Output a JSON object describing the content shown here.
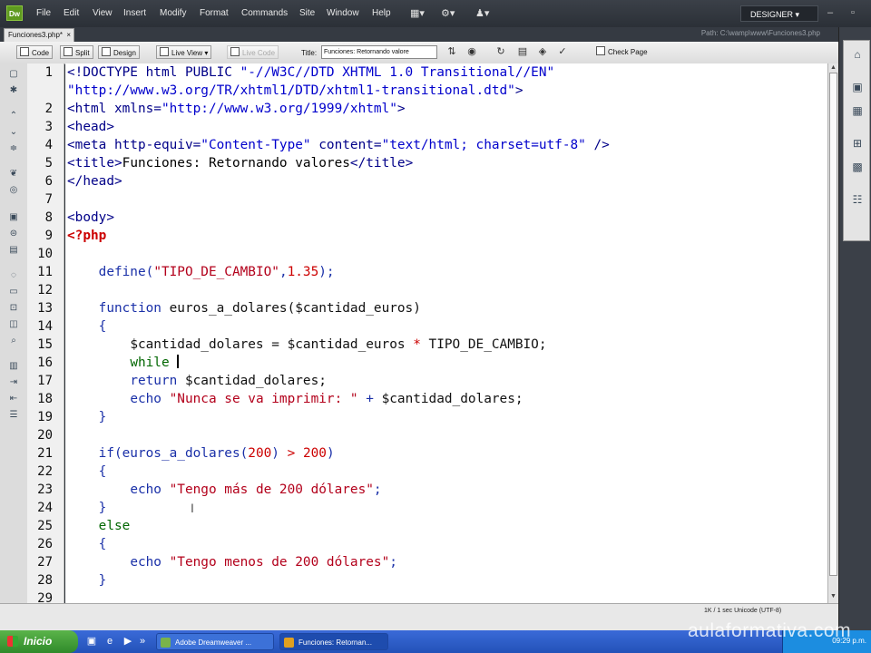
{
  "app": {
    "logo": "Dw",
    "workspace": "DESIGNER"
  },
  "menu": [
    "File",
    "Edit",
    "View",
    "Insert",
    "Modify",
    "Format",
    "Commands",
    "Site",
    "Window",
    "Help"
  ],
  "menu_icons": [
    "layout-icon",
    "gear-icon",
    "user-icon"
  ],
  "document": {
    "tab": "Funciones3.php*",
    "path": "Path: C:\\wamp\\www\\Funciones3.php"
  },
  "toolbar": {
    "code": "Code",
    "split": "Split",
    "design": "Design",
    "live_view": "Live View",
    "live_code": "Live Code",
    "title_label": "Title:",
    "title_value": "Funciones: Retornando valore",
    "check_page": "Check Page"
  },
  "line_numbers": [
    "1",
    "",
    "2",
    "3",
    "4",
    "5",
    "6",
    "7",
    "8",
    "9",
    "10",
    "11",
    "12",
    "13",
    "14",
    "15",
    "16",
    "17",
    "18",
    "19",
    "20",
    "21",
    "22",
    "23",
    "24",
    "25",
    "26",
    "27",
    "28",
    "29"
  ],
  "code": {
    "l1a": "<!DOCTYPE html PUBLIC ",
    "l1b": "\"-//W3C//DTD XHTML 1.0 Transitional//EN\"",
    "l1c": "\"http://www.w3.org/TR/xhtml1/DTD/xhtml1-transitional.dtd\"",
    "l1d": ">",
    "l2a": "<html xmlns=",
    "l2b": "\"http://www.w3.org/1999/xhtml\"",
    "l2c": ">",
    "l3": "<head>",
    "l4a": "<meta http-equiv=",
    "l4b": "\"Content-Type\"",
    "l4c": " content=",
    "l4d": "\"text/html; charset=utf-8\"",
    "l4e": " />",
    "l5a": "<title>",
    "l5b": "Funciones: Retornando valores",
    "l5c": "</title>",
    "l6": "</head>",
    "l8": "<body>",
    "l9": "<?php",
    "l11a": "define(",
    "l11b": "\"TIPO_DE_CAMBIO\"",
    "l11c": ",",
    "l11d": "1.35",
    "l11e": ");",
    "l13a": "function ",
    "l13b": "euros_a_dolares($cantidad_euros)",
    "l14": "{",
    "l15a": "$cantidad_dolares = $cantidad_euros ",
    "l15b": "*",
    "l15c": " TIPO_DE_CAMBIO;",
    "l16": "while ",
    "l17a": "return ",
    "l17b": "$cantidad_dolares;",
    "l18a": "echo ",
    "l18b": "\"Nunca se va imprimir: \"",
    "l18c": " + ",
    "l18d": "$cantidad_dolares;",
    "l19": "}",
    "l21a": "if(euros_a_dolares(",
    "l21b": "200",
    "l21c": ") ",
    "l21d": ">",
    "l21e": " ",
    "l21f": "200",
    "l21g": ")",
    "l22": "{",
    "l23a": "echo ",
    "l23b": "\"Tengo más de 200 dólares\"",
    "l23c": ";",
    "l24": "}",
    "l25": "else",
    "l26": "{",
    "l27a": "echo ",
    "l27b": "\"Tengo menos de 200 dólares\"",
    "l27c": ";",
    "l28": "}"
  },
  "status": {
    "text": "1K / 1 sec  Unicode (UTF-8)"
  },
  "taskbar": {
    "start": "Inicio",
    "tasks": [
      "Adobe Dreamweaver ...",
      "Funciones: Retornan..."
    ],
    "clock": "09:29 p.m."
  },
  "watermark": "aulaformativa.com",
  "colors": {
    "tag": "#000088",
    "string": "#0000cc",
    "php_string": "#b3001b",
    "keyword": "#1a30a8",
    "php_marker": "#cc0000",
    "control": "#006600"
  }
}
